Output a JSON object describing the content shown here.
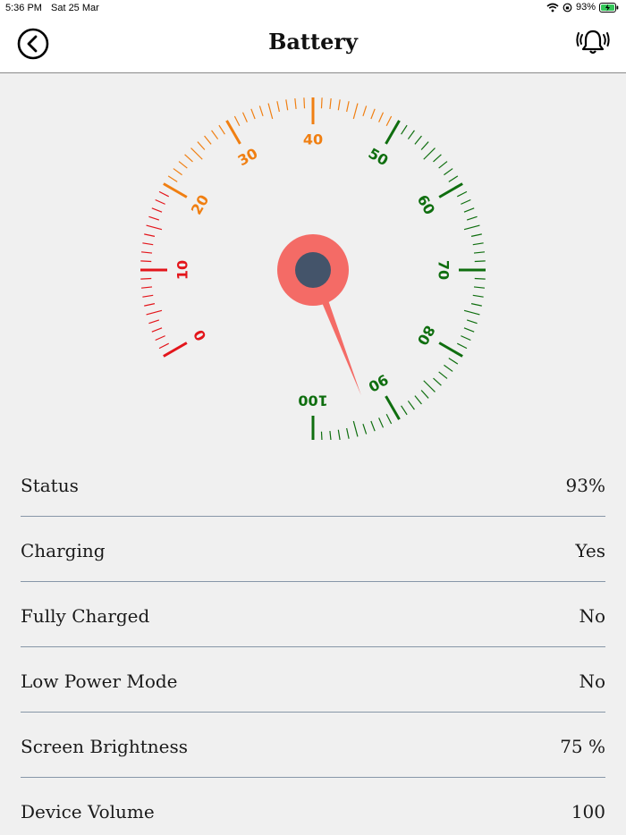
{
  "status_bar": {
    "time": "5:36 PM",
    "date": "Sat 25 Mar",
    "battery_percent": "93%"
  },
  "header": {
    "title": "Battery",
    "back_icon": "chevron-left-circle-icon",
    "alert_icon": "ringing-bell-icon"
  },
  "gauge": {
    "value": 93,
    "min": 0,
    "max": 100,
    "labels": [
      "0",
      "10",
      "20",
      "30",
      "40",
      "50",
      "60",
      "70",
      "80",
      "90",
      "100"
    ],
    "colors": {
      "low": "#e3151b",
      "mid": "#f07f12",
      "high": "#0f6e0f",
      "needle": "#f46b66",
      "hub": "#44546a"
    }
  },
  "rows": [
    {
      "label": "Status",
      "value": "93%"
    },
    {
      "label": "Charging",
      "value": "Yes"
    },
    {
      "label": "Fully Charged",
      "value": "No"
    },
    {
      "label": "Low Power Mode",
      "value": "No"
    },
    {
      "label": "Screen Brightness",
      "value": "75 %"
    },
    {
      "label": "Device Volume",
      "value": "100"
    }
  ]
}
